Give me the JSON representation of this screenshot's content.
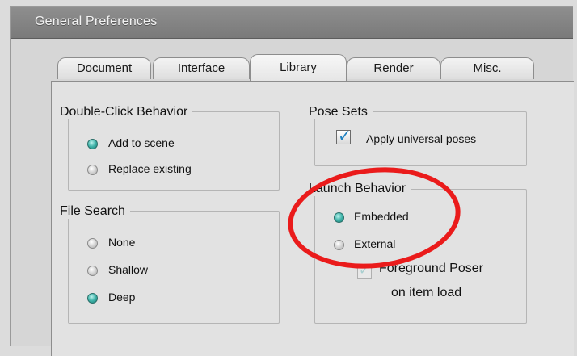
{
  "window": {
    "title": "General Preferences"
  },
  "tabs": [
    {
      "label": "Document"
    },
    {
      "label": "Interface"
    },
    {
      "label": "Library",
      "active": true
    },
    {
      "label": "Render"
    },
    {
      "label": "Misc."
    }
  ],
  "double_click": {
    "title": "Double-Click Behavior",
    "options": [
      {
        "label": "Add to scene",
        "selected": true
      },
      {
        "label": "Replace existing",
        "selected": false
      }
    ]
  },
  "file_search": {
    "title": "File Search",
    "options": [
      {
        "label": "None",
        "selected": false
      },
      {
        "label": "Shallow",
        "selected": false
      },
      {
        "label": "Deep",
        "selected": true
      }
    ]
  },
  "pose_sets": {
    "title": "Pose Sets",
    "apply_universal_label": "Apply universal poses",
    "apply_universal_checked": true
  },
  "launch_behavior": {
    "title": "Launch Behavior",
    "options": [
      {
        "label": "Embedded",
        "selected": true
      },
      {
        "label": "External",
        "selected": false
      }
    ],
    "foreground_label_line1": "Foreground Poser",
    "foreground_label_line2": "on item load",
    "foreground_checked": true,
    "foreground_disabled": true
  },
  "annotation": {
    "color": "#ea1b1b"
  },
  "colors": {
    "accent": "#3fb3a9",
    "title_bar": "#7f7f7f"
  }
}
